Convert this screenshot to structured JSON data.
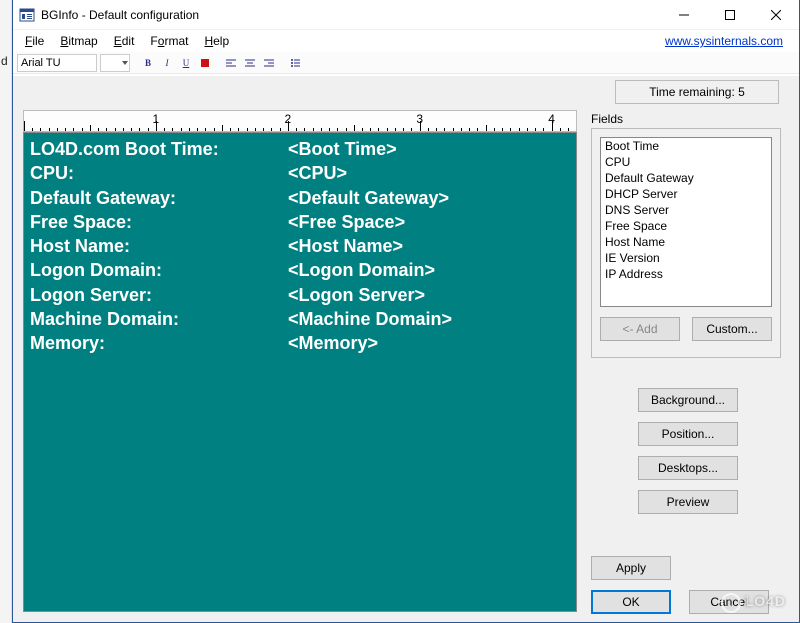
{
  "window": {
    "title": "BGInfo - Default configuration"
  },
  "menu": {
    "file": "File",
    "bitmap": "Bitmap",
    "edit": "Edit",
    "format": "Format",
    "help": "Help",
    "link": "www.sysinternals.com"
  },
  "toolbar": {
    "font": "Arial TU",
    "size_placeholder": ""
  },
  "timer": {
    "label": "Time remaining: 5"
  },
  "editor_rows": [
    {
      "label": "LO4D.com Boot Time:",
      "value": "<Boot Time>"
    },
    {
      "label": "CPU:",
      "value": "<CPU>"
    },
    {
      "label": "Default Gateway:",
      "value": "<Default Gateway>"
    },
    {
      "label": "Free Space:",
      "value": "<Free Space>"
    },
    {
      "label": "Host Name:",
      "value": "<Host Name>"
    },
    {
      "label": "Logon Domain:",
      "value": "<Logon Domain>"
    },
    {
      "label": "Logon Server:",
      "value": "<Logon Server>"
    },
    {
      "label": "Machine Domain:",
      "value": "<Machine Domain>"
    },
    {
      "label": "Memory:",
      "value": "<Memory>"
    }
  ],
  "fields": {
    "heading": "Fields",
    "items": [
      "Boot Time",
      "CPU",
      "Default Gateway",
      "DHCP Server",
      "DNS Server",
      "Free Space",
      "Host Name",
      "IE Version",
      "IP Address"
    ],
    "add_btn": "<- Add",
    "custom_btn": "Custom..."
  },
  "buttons": {
    "background": "Background...",
    "position": "Position...",
    "desktops": "Desktops...",
    "preview": "Preview",
    "apply": "Apply",
    "ok": "OK",
    "cancel": "Cancel"
  },
  "ruler": {
    "numbers": [
      "1",
      "2",
      "3",
      "4"
    ]
  },
  "watermark": "LO4D"
}
